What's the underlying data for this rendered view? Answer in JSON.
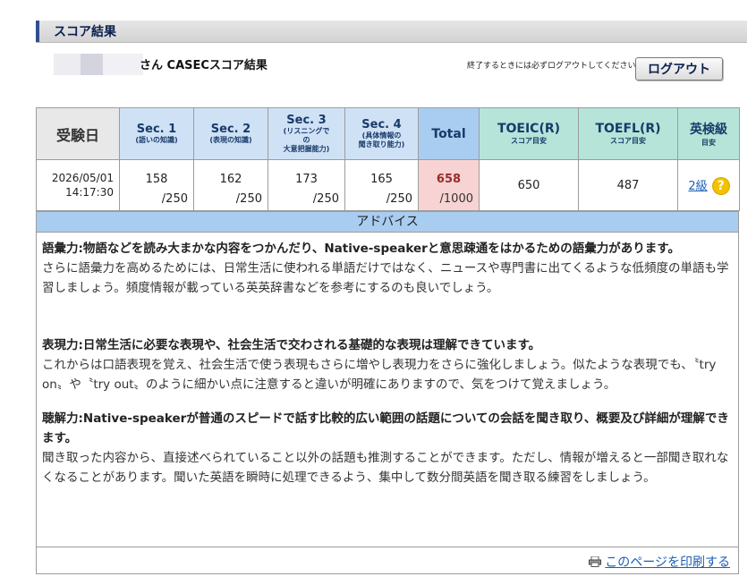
{
  "header": {
    "title": "スコア結果"
  },
  "user": {
    "suffix": "さん CASECスコア結果"
  },
  "logout": {
    "note": "終了するときには必ずログアウトしてください",
    "button": "ログアウト"
  },
  "table": {
    "headers": {
      "date": "受験日",
      "sec1": {
        "title": "Sec. 1",
        "sub": "(語いの知識)"
      },
      "sec2": {
        "title": "Sec. 2",
        "sub": "(表現の知識)"
      },
      "sec3": {
        "title": "Sec. 3",
        "sub1": "(リスニングで",
        "sub2": "の",
        "sub3": "大意把握能力)"
      },
      "sec4": {
        "title": "Sec. 4",
        "sub1": "(具体情報の",
        "sub2": "聞き取り能力)"
      },
      "total": "Total",
      "toeic": {
        "title": "TOEIC(R)",
        "sub": "スコア目安"
      },
      "toefl": {
        "title": "TOEFL(R)",
        "sub": "スコア目安"
      },
      "eiken": {
        "title": "英検級",
        "sub": "目安"
      }
    },
    "row": {
      "date": "2026/05/01",
      "time": "14:17:30",
      "sec1": "158",
      "sec1_max": "/250",
      "sec2": "162",
      "sec2_max": "/250",
      "sec3": "173",
      "sec3_max": "/250",
      "sec4": "165",
      "sec4_max": "/250",
      "total": "658",
      "total_max": "/1000",
      "toeic": "650",
      "toefl": "487",
      "eiken": "2級",
      "help_icon": "?"
    }
  },
  "advice": {
    "title": "アドバイス",
    "items": [
      {
        "heading": "語彙力:物語などを読み大まかな内容をつかんだり、Native-speakerと意思疎通をはかるための語彙力があります。",
        "body": "さらに語彙力を高めるためには、日常生活に使われる単語だけではなく、ニュースや専門書に出てくるような低頻度の単語も学習しましょう。頻度情報が載っている英英辞書などを参考にするのも良いでしょう。"
      },
      {
        "heading": "表現力:日常生活に必要な表現や、社会生活で交わされる基礎的な表現は理解できています。",
        "body": "これからは口語表現を覚え、社会生活で使う表現もさらに増やし表現力をさらに強化しましょう。似たような表現でも、〝try on〟や〝try out〟のように細かい点に注意すると違いが明確にありますので、気をつけて覚えましょう。"
      },
      {
        "heading": "聴解力:Native-speakerが普通のスピードで話す比較的広い範囲の話題についての会話を聞き取り、概要及び詳細が理解できます。",
        "body": "聞き取った内容から、直接述べられていること以外の話題も推測することができます。ただし、情報が増えると一部聞き取れなくなることがあります。聞いた英語を瞬時に処理できるよう、集中して数分間英語を聞き取る練習をしましょう。"
      }
    ]
  },
  "print": {
    "label": "このページを印刷する"
  }
}
